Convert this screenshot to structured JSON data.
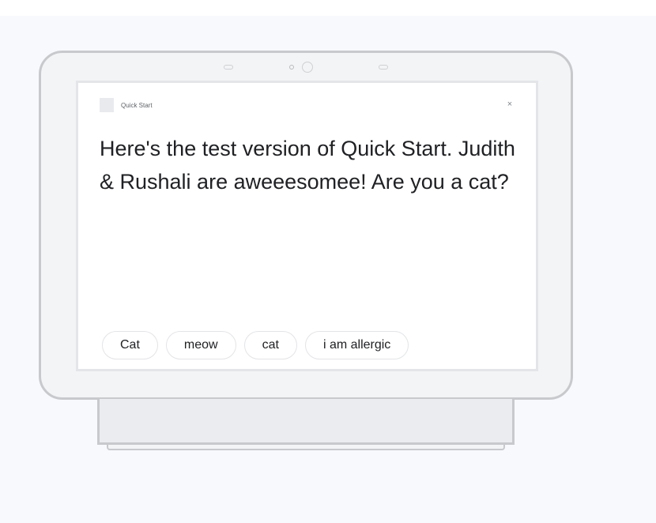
{
  "app": {
    "name": "Quick Start",
    "logo_icon": "app-logo-icon",
    "close_glyph": "×"
  },
  "message": {
    "text": "Here's the test version of Quick Start. Judith & Rushali are aweeesomee! Are you a cat?"
  },
  "suggestion_chips": [
    {
      "label": "Cat"
    },
    {
      "label": "meow"
    },
    {
      "label": "cat"
    },
    {
      "label": "i am allergic"
    }
  ],
  "colors": {
    "background": "#f8f9fc",
    "device_frame": "#c8c9cc",
    "screen": "#ffffff",
    "text": "#202124"
  }
}
